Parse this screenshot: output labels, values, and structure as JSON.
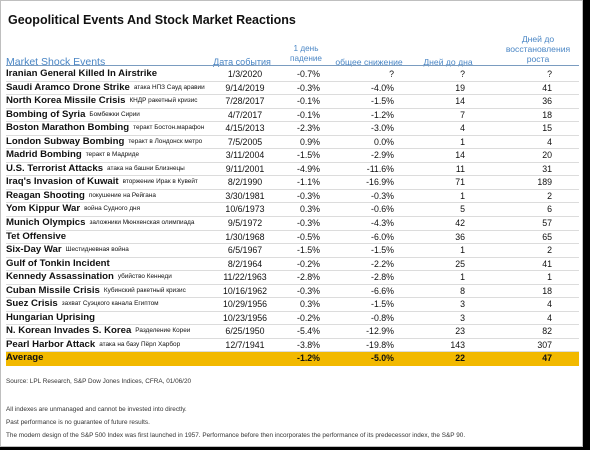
{
  "title": "Geopolitical Events And Stock Market Reactions",
  "headers": {
    "event": "Market Shock Events",
    "date": "Дата события",
    "one_day_l1": "1 день",
    "one_day_l2": "падение",
    "total": "общее снижение",
    "days_bottom": "Дней до дна",
    "recovery_l1": "Дней до",
    "recovery_l2": "восстановления",
    "recovery_l3": "роста"
  },
  "rows": [
    {
      "event": "Iranian General Killed In Airstrike",
      "note": "",
      "date": "1/3/2020",
      "one_day": "-0.7%",
      "total": "?",
      "days_bottom": "?",
      "recovery": "?"
    },
    {
      "event": "Saudi Aramco Drone Strike",
      "note": "атака НПЗ Сауд аравии",
      "date": "9/14/2019",
      "one_day": "-0.3%",
      "total": "-4.0%",
      "days_bottom": "19",
      "recovery": "41"
    },
    {
      "event": "North Korea Missile Crisis",
      "note": "КНДР ракетный кризис",
      "date": "7/28/2017",
      "one_day": "-0.1%",
      "total": "-1.5%",
      "days_bottom": "14",
      "recovery": "36"
    },
    {
      "event": "Bombing of Syria",
      "note": "Бомбежки Сирии",
      "date": "4/7/2017",
      "one_day": "-0.1%",
      "total": "-1.2%",
      "days_bottom": "7",
      "recovery": "18"
    },
    {
      "event": "Boston Marathon Bombing",
      "note": "теракт Бостон.марафон",
      "date": "4/15/2013",
      "one_day": "-2.3%",
      "total": "-3.0%",
      "days_bottom": "4",
      "recovery": "15"
    },
    {
      "event": "London Subway Bombing",
      "note": "теракт в Лондонск метро",
      "date": "7/5/2005",
      "one_day": "0.9%",
      "total": "0.0%",
      "days_bottom": "1",
      "recovery": "4"
    },
    {
      "event": "Madrid Bombing",
      "note": "теракт в Мадриде",
      "date": "3/11/2004",
      "one_day": "-1.5%",
      "total": "-2.9%",
      "days_bottom": "14",
      "recovery": "20"
    },
    {
      "event": "U.S. Terrorist Attacks",
      "note": "атака на башни Близнецы",
      "date": "9/11/2001",
      "one_day": "-4.9%",
      "total": "-11.6%",
      "days_bottom": "11",
      "recovery": "31"
    },
    {
      "event": "Iraq's Invasion of Kuwait",
      "note": "вторжение Ирак в Кувейт",
      "date": "8/2/1990",
      "one_day": "-1.1%",
      "total": "-16.9%",
      "days_bottom": "71",
      "recovery": "189"
    },
    {
      "event": "Reagan Shooting",
      "note": "покушение на Рейгана",
      "date": "3/30/1981",
      "one_day": "-0.3%",
      "total": "-0.3%",
      "days_bottom": "1",
      "recovery": "2"
    },
    {
      "event": "Yom Kippur War",
      "note": "война Судного дня",
      "date": "10/6/1973",
      "one_day": "0.3%",
      "total": "-0.6%",
      "days_bottom": "5",
      "recovery": "6"
    },
    {
      "event": "Munich Olympics",
      "note": "заложники Мюнхенская олимпиада",
      "date": "9/5/1972",
      "one_day": "-0.3%",
      "total": "-4.3%",
      "days_bottom": "42",
      "recovery": "57"
    },
    {
      "event": "Tet Offensive",
      "note": "",
      "date": "1/30/1968",
      "one_day": "-0.5%",
      "total": "-6.0%",
      "days_bottom": "36",
      "recovery": "65"
    },
    {
      "event": "Six-Day War",
      "note": "Шестидневная война",
      "date": "6/5/1967",
      "one_day": "-1.5%",
      "total": "-1.5%",
      "days_bottom": "1",
      "recovery": "2"
    },
    {
      "event": "Gulf of Tonkin Incident",
      "note": "",
      "date": "8/2/1964",
      "one_day": "-0.2%",
      "total": "-2.2%",
      "days_bottom": "25",
      "recovery": "41"
    },
    {
      "event": "Kennedy Assassination",
      "note": "убийство Кеннеди",
      "date": "11/22/1963",
      "one_day": "-2.8%",
      "total": "-2.8%",
      "days_bottom": "1",
      "recovery": "1"
    },
    {
      "event": "Cuban Missile Crisis",
      "note": "Кубинский ракетный кризис",
      "date": "10/16/1962",
      "one_day": "-0.3%",
      "total": "-6.6%",
      "days_bottom": "8",
      "recovery": "18"
    },
    {
      "event": "Suez Crisis",
      "note": "захват Суэцкого канала Египтом",
      "date": "10/29/1956",
      "one_day": "0.3%",
      "total": "-1.5%",
      "days_bottom": "3",
      "recovery": "4"
    },
    {
      "event": "Hungarian Uprising",
      "note": "",
      "date": "10/23/1956",
      "one_day": "-0.2%",
      "total": "-0.8%",
      "days_bottom": "3",
      "recovery": "4"
    },
    {
      "event": "N. Korean Invades S. Korea",
      "note": "Разделение Кореи",
      "date": "6/25/1950",
      "one_day": "-5.4%",
      "total": "-12.9%",
      "days_bottom": "23",
      "recovery": "82"
    },
    {
      "event": "Pearl Harbor Attack",
      "note": "атака на базу Пёрл Харбор",
      "date": "12/7/1941",
      "one_day": "-3.8%",
      "total": "-19.8%",
      "days_bottom": "143",
      "recovery": "307"
    }
  ],
  "average": {
    "label": "Average",
    "one_day": "-1.2%",
    "total": "-5.0%",
    "days_bottom": "22",
    "recovery": "47"
  },
  "footer": {
    "source": "Source: LPL Research, S&P Dow Jones Indices, CFRA, 01/06/20",
    "note1": "All indexes are unmanaged and cannot be invested into directly.",
    "note2": "Past performance is no guarantee of future results.",
    "note3": "The modern design of the S&P 500 Index was first launched in 1957. Performance before then incorporates the performance of its predecessor index, the S&P 90."
  },
  "colors": {
    "header_text": "#4a86c5",
    "average_bg": "#f2b900",
    "rule": "#7a9cc0"
  }
}
